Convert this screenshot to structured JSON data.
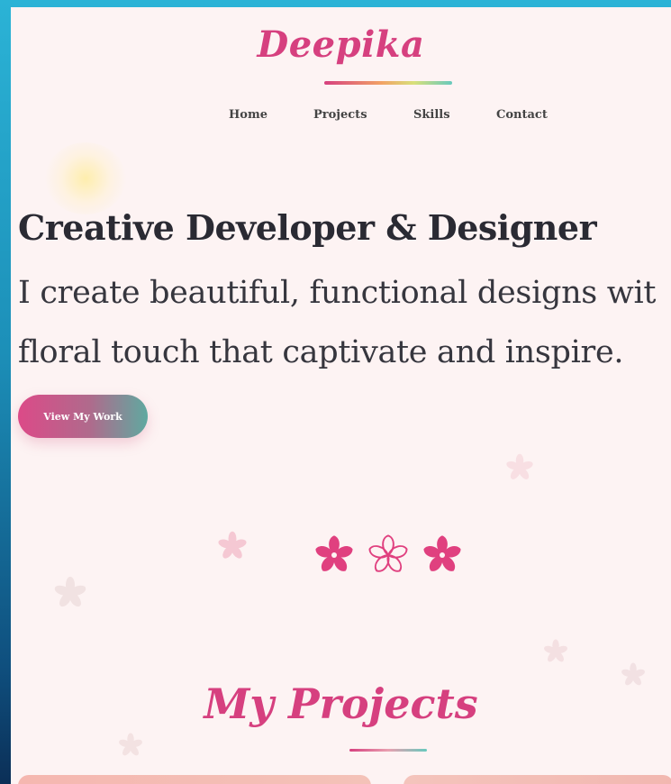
{
  "brand": {
    "name": "Deepika"
  },
  "nav": {
    "items": [
      "Home",
      "Projects",
      "Skills",
      "Contact"
    ]
  },
  "hero": {
    "headline": "Creative Developer & Designer",
    "subtitle_line1": "I create beautiful, functional designs wit",
    "subtitle_line2": "floral touch that captivate and inspire.",
    "cta_label": "View My Work"
  },
  "projects": {
    "title": "My Projects"
  },
  "colors": {
    "accent_pink": "#d6407f",
    "accent_teal": "#67c9bd",
    "page_bg": "#fdf3f3",
    "text_dark": "#2a2a33"
  },
  "icons": [
    "flower-icon"
  ]
}
